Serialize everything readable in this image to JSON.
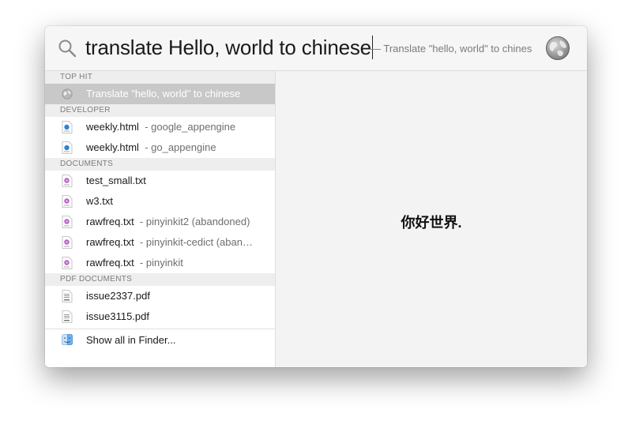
{
  "search": {
    "query": "translate Hello, world to chinese",
    "completion": "— Translate \"hello, world\" to chinese"
  },
  "icons": {
    "search": "search-icon",
    "globe": "globe-icon",
    "html_file": "html-file-icon",
    "text_file": "text-file-icon",
    "pdf_file": "pdf-file-icon",
    "finder": "finder-icon"
  },
  "colors": {
    "selection": "#c8c8c8",
    "section_bg": "#eeeeee",
    "preview_bg": "#f3f3f3"
  },
  "sections": {
    "top_hit": {
      "title": "TOP HIT",
      "items": [
        {
          "name": "Translate \"hello, world\" to chinese",
          "sub": ""
        }
      ]
    },
    "developer": {
      "title": "DEVELOPER",
      "items": [
        {
          "name": "weekly.html",
          "sub": "- google_appengine"
        },
        {
          "name": "weekly.html",
          "sub": "- go_appengine"
        }
      ]
    },
    "documents": {
      "title": "DOCUMENTS",
      "items": [
        {
          "name": "test_small.txt",
          "sub": ""
        },
        {
          "name": "w3.txt",
          "sub": ""
        },
        {
          "name": "rawfreq.txt",
          "sub": "- pinyinkit2 (abandoned)"
        },
        {
          "name": "rawfreq.txt",
          "sub": "- pinyinkit-cedict (aban…"
        },
        {
          "name": "rawfreq.txt",
          "sub": "- pinyinkit"
        }
      ]
    },
    "pdf_documents": {
      "title": "PDF DOCUMENTS",
      "items": [
        {
          "name": "issue2337.pdf",
          "sub": ""
        },
        {
          "name": "issue3115.pdf",
          "sub": ""
        }
      ]
    }
  },
  "footer": {
    "label": "Show all in Finder..."
  },
  "preview": {
    "result": "你好世界."
  }
}
